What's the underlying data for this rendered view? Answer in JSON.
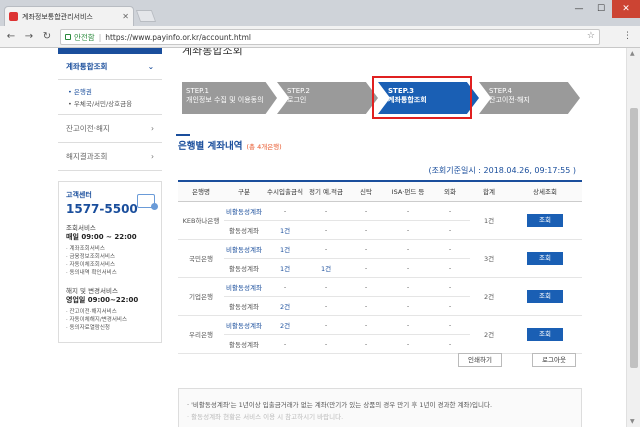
{
  "browser": {
    "tab_title": "계좌정보통합관리서비스",
    "secure_label": "안전함",
    "url": "https://www.payinfo.or.kr/account.html"
  },
  "sidebar": {
    "header": "계좌통합조회",
    "sub_items": [
      "은행권",
      "우체국/서민/상호금융"
    ],
    "items": [
      "잔고이전·해지",
      "해지결과조회"
    ],
    "cc": {
      "title": "고객센터",
      "phone": "1577-5500",
      "inq_label": "조회서비스",
      "inq_hours": "매일 09:00 ~ 22:00",
      "inq_list": [
        "계좌조회서비스",
        "금융정보조회서비스",
        "자동이체조회서비스",
        "동의내역 확인서비스"
      ],
      "chg_label": "해지 및 변경서비스",
      "chg_hours": "영업일 09:00~22:00",
      "chg_list": [
        "잔고이전·해지서비스",
        "자동이체해지/변경서비스",
        "동의자료열람신청"
      ]
    }
  },
  "main": {
    "title": "계좌통합조회",
    "steps": [
      {
        "num": "STEP.1",
        "label": "개인정보 수집 및 이용동의"
      },
      {
        "num": "STEP.2",
        "label": "로그인"
      },
      {
        "num": "STEP.3",
        "label": "계좌통합조회"
      },
      {
        "num": "STEP.4",
        "label": "잔고이전·해지"
      }
    ],
    "section_title": "은행별 계좌내역",
    "section_sub": "(총 4개은행)",
    "basis": "(조회기준일시 : 2018.04.26, 09:17:55 )",
    "columns": [
      "은행명",
      "구분",
      "수시입출금식",
      "정기 예,적금",
      "신탁",
      "ISA·펀드 등",
      "외화",
      "합계",
      "상세조회"
    ],
    "rows": [
      {
        "bank": "KEB하나은행",
        "total": "1건",
        "detail": "조회",
        "sub": [
          {
            "type": "비활동성계좌",
            "vals": [
              "-",
              "-",
              "-",
              "-",
              "-"
            ]
          },
          {
            "type": "활동성계좌",
            "vals": [
              "1건",
              "-",
              "-",
              "-",
              "-"
            ]
          }
        ]
      },
      {
        "bank": "국민은행",
        "total": "3건",
        "detail": "조회",
        "sub": [
          {
            "type": "비활동성계좌",
            "vals": [
              "1건",
              "-",
              "-",
              "-",
              "-"
            ]
          },
          {
            "type": "활동성계좌",
            "vals": [
              "1건",
              "1건",
              "-",
              "-",
              "-"
            ]
          }
        ]
      },
      {
        "bank": "기업은행",
        "total": "2건",
        "detail": "조회",
        "sub": [
          {
            "type": "비활동성계좌",
            "vals": [
              "-",
              "-",
              "-",
              "-",
              "-"
            ]
          },
          {
            "type": "활동성계좌",
            "vals": [
              "2건",
              "-",
              "-",
              "-",
              "-"
            ]
          }
        ]
      },
      {
        "bank": "우리은행",
        "total": "2건",
        "detail": "조회",
        "sub": [
          {
            "type": "비활동성계좌",
            "vals": [
              "2건",
              "-",
              "-",
              "-",
              "-"
            ]
          },
          {
            "type": "활동성계좌",
            "vals": [
              "-",
              "-",
              "-",
              "-",
              "-"
            ]
          }
        ]
      }
    ],
    "print_label": "인쇄하기",
    "logout_label": "로그아웃",
    "note1": "· '비활동성계좌'는 1년이상 입출금거래가 없는 계좌(만기가 있는 상품의 경우 만기 후 1년이 경과한 계좌)입니다.",
    "note2": "· 활동성계좌 현황은 서비스 이용 시 참고하시기 바랍니다."
  }
}
